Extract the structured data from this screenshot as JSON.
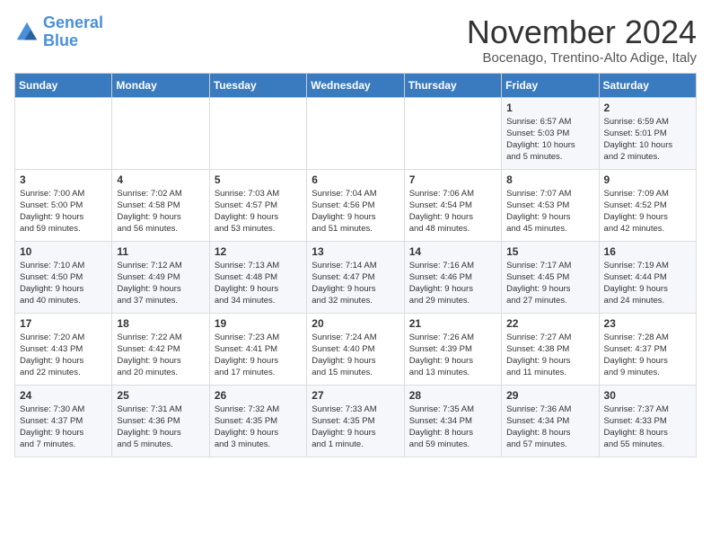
{
  "logo": {
    "line1": "General",
    "line2": "Blue"
  },
  "title": "November 2024",
  "location": "Bocenago, Trentino-Alto Adige, Italy",
  "weekdays": [
    "Sunday",
    "Monday",
    "Tuesday",
    "Wednesday",
    "Thursday",
    "Friday",
    "Saturday"
  ],
  "weeks": [
    [
      {
        "day": "",
        "info": ""
      },
      {
        "day": "",
        "info": ""
      },
      {
        "day": "",
        "info": ""
      },
      {
        "day": "",
        "info": ""
      },
      {
        "day": "",
        "info": ""
      },
      {
        "day": "1",
        "info": "Sunrise: 6:57 AM\nSunset: 5:03 PM\nDaylight: 10 hours\nand 5 minutes."
      },
      {
        "day": "2",
        "info": "Sunrise: 6:59 AM\nSunset: 5:01 PM\nDaylight: 10 hours\nand 2 minutes."
      }
    ],
    [
      {
        "day": "3",
        "info": "Sunrise: 7:00 AM\nSunset: 5:00 PM\nDaylight: 9 hours\nand 59 minutes."
      },
      {
        "day": "4",
        "info": "Sunrise: 7:02 AM\nSunset: 4:58 PM\nDaylight: 9 hours\nand 56 minutes."
      },
      {
        "day": "5",
        "info": "Sunrise: 7:03 AM\nSunset: 4:57 PM\nDaylight: 9 hours\nand 53 minutes."
      },
      {
        "day": "6",
        "info": "Sunrise: 7:04 AM\nSunset: 4:56 PM\nDaylight: 9 hours\nand 51 minutes."
      },
      {
        "day": "7",
        "info": "Sunrise: 7:06 AM\nSunset: 4:54 PM\nDaylight: 9 hours\nand 48 minutes."
      },
      {
        "day": "8",
        "info": "Sunrise: 7:07 AM\nSunset: 4:53 PM\nDaylight: 9 hours\nand 45 minutes."
      },
      {
        "day": "9",
        "info": "Sunrise: 7:09 AM\nSunset: 4:52 PM\nDaylight: 9 hours\nand 42 minutes."
      }
    ],
    [
      {
        "day": "10",
        "info": "Sunrise: 7:10 AM\nSunset: 4:50 PM\nDaylight: 9 hours\nand 40 minutes."
      },
      {
        "day": "11",
        "info": "Sunrise: 7:12 AM\nSunset: 4:49 PM\nDaylight: 9 hours\nand 37 minutes."
      },
      {
        "day": "12",
        "info": "Sunrise: 7:13 AM\nSunset: 4:48 PM\nDaylight: 9 hours\nand 34 minutes."
      },
      {
        "day": "13",
        "info": "Sunrise: 7:14 AM\nSunset: 4:47 PM\nDaylight: 9 hours\nand 32 minutes."
      },
      {
        "day": "14",
        "info": "Sunrise: 7:16 AM\nSunset: 4:46 PM\nDaylight: 9 hours\nand 29 minutes."
      },
      {
        "day": "15",
        "info": "Sunrise: 7:17 AM\nSunset: 4:45 PM\nDaylight: 9 hours\nand 27 minutes."
      },
      {
        "day": "16",
        "info": "Sunrise: 7:19 AM\nSunset: 4:44 PM\nDaylight: 9 hours\nand 24 minutes."
      }
    ],
    [
      {
        "day": "17",
        "info": "Sunrise: 7:20 AM\nSunset: 4:43 PM\nDaylight: 9 hours\nand 22 minutes."
      },
      {
        "day": "18",
        "info": "Sunrise: 7:22 AM\nSunset: 4:42 PM\nDaylight: 9 hours\nand 20 minutes."
      },
      {
        "day": "19",
        "info": "Sunrise: 7:23 AM\nSunset: 4:41 PM\nDaylight: 9 hours\nand 17 minutes."
      },
      {
        "day": "20",
        "info": "Sunrise: 7:24 AM\nSunset: 4:40 PM\nDaylight: 9 hours\nand 15 minutes."
      },
      {
        "day": "21",
        "info": "Sunrise: 7:26 AM\nSunset: 4:39 PM\nDaylight: 9 hours\nand 13 minutes."
      },
      {
        "day": "22",
        "info": "Sunrise: 7:27 AM\nSunset: 4:38 PM\nDaylight: 9 hours\nand 11 minutes."
      },
      {
        "day": "23",
        "info": "Sunrise: 7:28 AM\nSunset: 4:37 PM\nDaylight: 9 hours\nand 9 minutes."
      }
    ],
    [
      {
        "day": "24",
        "info": "Sunrise: 7:30 AM\nSunset: 4:37 PM\nDaylight: 9 hours\nand 7 minutes."
      },
      {
        "day": "25",
        "info": "Sunrise: 7:31 AM\nSunset: 4:36 PM\nDaylight: 9 hours\nand 5 minutes."
      },
      {
        "day": "26",
        "info": "Sunrise: 7:32 AM\nSunset: 4:35 PM\nDaylight: 9 hours\nand 3 minutes."
      },
      {
        "day": "27",
        "info": "Sunrise: 7:33 AM\nSunset: 4:35 PM\nDaylight: 9 hours\nand 1 minute."
      },
      {
        "day": "28",
        "info": "Sunrise: 7:35 AM\nSunset: 4:34 PM\nDaylight: 8 hours\nand 59 minutes."
      },
      {
        "day": "29",
        "info": "Sunrise: 7:36 AM\nSunset: 4:34 PM\nDaylight: 8 hours\nand 57 minutes."
      },
      {
        "day": "30",
        "info": "Sunrise: 7:37 AM\nSunset: 4:33 PM\nDaylight: 8 hours\nand 55 minutes."
      }
    ]
  ]
}
